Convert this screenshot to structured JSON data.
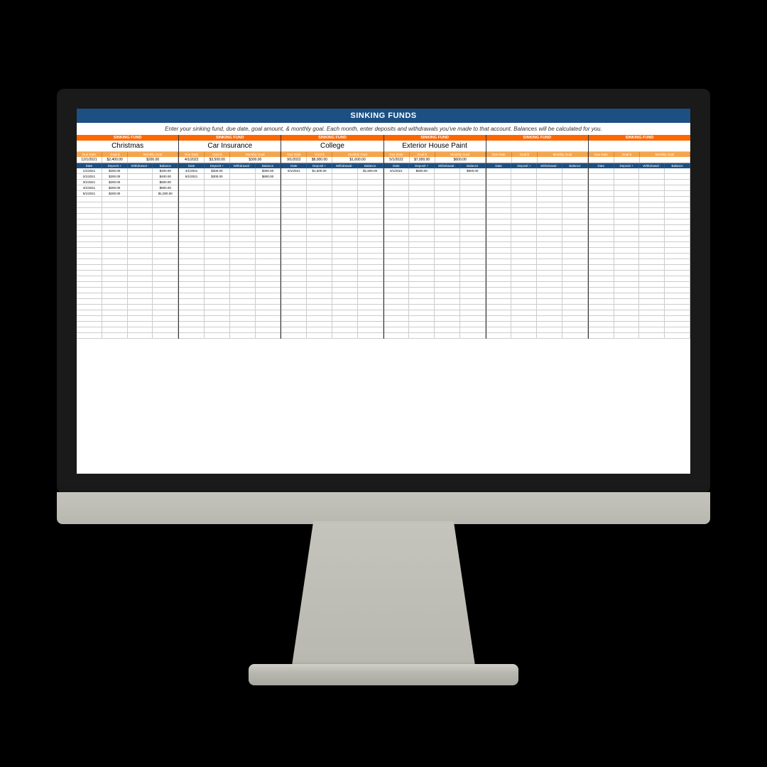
{
  "title": "SINKING FUNDS",
  "instructions": "Enter your sinking fund, due date, goal amount, & monthly goal. Each month, enter deposits and withdrawals you've made to that account. Balances will be calculated for you.",
  "fund_label": "SINKING FUND",
  "goal_headers": {
    "due_date": "Due Date",
    "goal": "Goal $",
    "monthly": "Monthly Goal"
  },
  "tx_headers": {
    "date": "Date",
    "deposit": "Deposit +",
    "withdrawal": "Withdrawal -",
    "balance": "Balance"
  },
  "funds": [
    {
      "name": "Christmas",
      "due_date": "12/1/2021",
      "goal": "$2,400.00",
      "monthly": "$200.00",
      "transactions": [
        {
          "date": "1/1/2021",
          "deposit": "$200.00",
          "withdrawal": "",
          "balance": "$200.00"
        },
        {
          "date": "2/1/2021",
          "deposit": "$200.00",
          "withdrawal": "",
          "balance": "$400.00"
        },
        {
          "date": "3/1/2021",
          "deposit": "$200.00",
          "withdrawal": "",
          "balance": "$600.00"
        },
        {
          "date": "4/1/2021",
          "deposit": "$200.00",
          "withdrawal": "",
          "balance": "$800.00"
        },
        {
          "date": "5/1/2021",
          "deposit": "$200.00",
          "withdrawal": "",
          "balance": "$1,000.00"
        }
      ]
    },
    {
      "name": "Car Insurance",
      "due_date": "4/1/2022",
      "goal": "$3,500.00",
      "monthly": "$300.00",
      "transactions": [
        {
          "date": "4/1/2021",
          "deposit": "$300.00",
          "withdrawal": "",
          "balance": "$300.00"
        },
        {
          "date": "5/1/2021",
          "deposit": "$300.00",
          "withdrawal": "",
          "balance": "$600.00"
        }
      ]
    },
    {
      "name": "College",
      "due_date": "9/1/2022",
      "goal": "$8,000.00",
      "monthly": "$1,600.00",
      "transactions": [
        {
          "date": "5/1/2021",
          "deposit": "$1,600.00",
          "withdrawal": "",
          "balance": "$1,600.00"
        }
      ]
    },
    {
      "name": "Exterior House Paint",
      "due_date": "5/1/2022",
      "goal": "$7,000.00",
      "monthly": "$600.00",
      "transactions": [
        {
          "date": "5/1/2021",
          "deposit": "$600.00",
          "withdrawal": "",
          "balance": "$600.00"
        }
      ]
    },
    {
      "name": "",
      "due_date": "",
      "goal": "",
      "monthly": "",
      "transactions": []
    },
    {
      "name": "",
      "due_date": "",
      "goal": "",
      "monthly": "",
      "transactions": []
    }
  ],
  "empty_rows": 30
}
